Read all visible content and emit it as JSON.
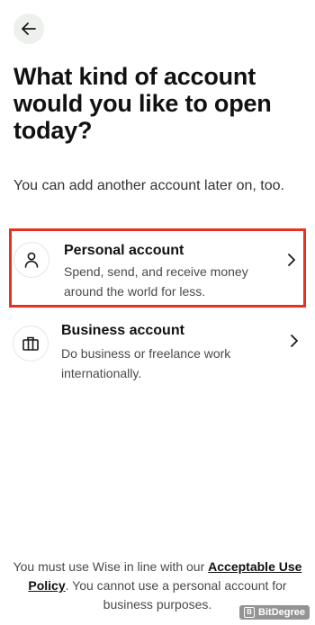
{
  "header": {
    "back_icon": "arrow-left-icon",
    "title": "What kind of account would you like to open today?",
    "subtitle": "You can add another account later on, too."
  },
  "options": [
    {
      "icon": "person-icon",
      "title": "Personal account",
      "description": "Spend, send, and receive money around the world for less.",
      "highlighted": true,
      "highlight_color": "#e8321f"
    },
    {
      "icon": "briefcase-icon",
      "title": "Business account",
      "description": "Do business or freelance work internationally.",
      "highlighted": false
    }
  ],
  "footer": {
    "text_before": "You must use Wise in line with our ",
    "link_text": "Acceptable Use Policy",
    "text_after": ". You cannot use a personal account for business purposes."
  },
  "watermark": {
    "text": "BitDegree"
  }
}
